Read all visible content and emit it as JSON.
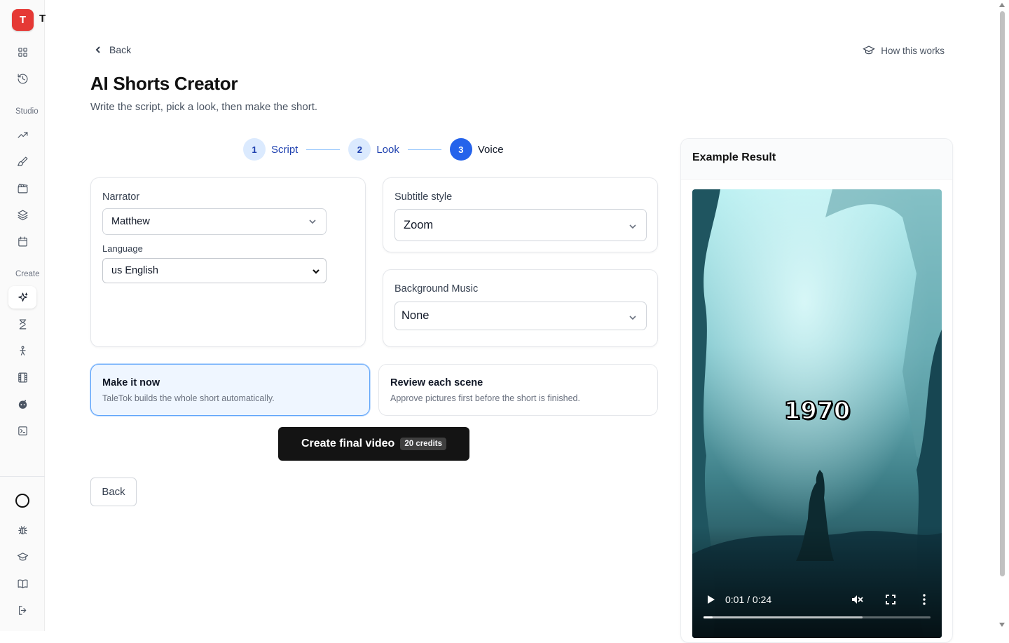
{
  "app": {
    "logo_letter": "T",
    "logo_tail": "T"
  },
  "sidebar": {
    "top_icons": [
      "grid-icon",
      "history-icon"
    ],
    "studio_label": "Studio",
    "studio_icons": [
      "trending-icon",
      "brush-icon",
      "clapperboard-icon",
      "layers-icon",
      "calendar-icon"
    ],
    "create_label": "Create",
    "create_icons": [
      "sparkles-icon",
      "hourglass-icon",
      "person-icon",
      "film-icon",
      "reddit-icon",
      "terminal-icon"
    ],
    "bottom_icons": [
      "bug-icon",
      "graduation-cap-icon",
      "book-icon",
      "logout-icon"
    ]
  },
  "header": {
    "back_label": "Back",
    "how_label": "How this works",
    "title": "AI Shorts Creator",
    "subtitle": "Write the script, pick a look, then make the short."
  },
  "steps": [
    {
      "num": "1",
      "label": "Script"
    },
    {
      "num": "2",
      "label": "Look"
    },
    {
      "num": "3",
      "label": "Voice"
    }
  ],
  "narrator": {
    "label": "Narrator",
    "value": "Matthew",
    "language_label": "Language",
    "language_value": "us English"
  },
  "subtitle_style": {
    "label": "Subtitle style",
    "value": "Zoom"
  },
  "music": {
    "label": "Background Music",
    "value": "None"
  },
  "modes": [
    {
      "title": "Make it now",
      "desc": "TaleTok builds the whole short automatically."
    },
    {
      "title": "Review each scene",
      "desc": "Approve pictures first before the short is finished."
    }
  ],
  "create_button": {
    "label": "Create final video",
    "credits": "20 credits"
  },
  "back_button": "Back",
  "example": {
    "title": "Example Result",
    "caption": "1970",
    "time": "0:01 / 0:24",
    "progress_played": 0.04,
    "progress_buffered": 0.7
  }
}
